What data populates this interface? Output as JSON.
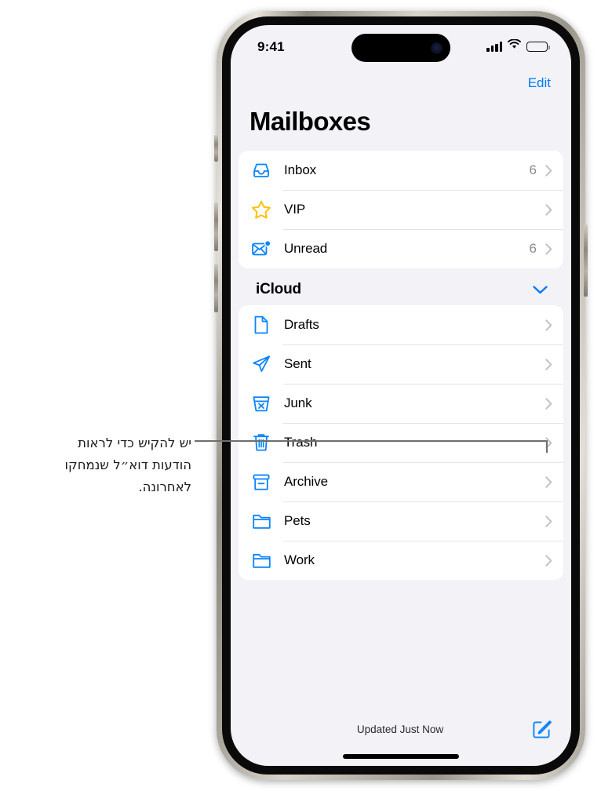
{
  "callout": {
    "lines": [
      "יש להקיש כדי לראות",
      "הודעות דוא״ל שנמחקו",
      "לאחרונה."
    ],
    "target_row": "Trash"
  },
  "status_bar": {
    "time": "9:41",
    "cellular_icon": "cellular-bars-icon",
    "wifi_icon": "wifi-icon",
    "battery_icon": "battery-icon",
    "battery_level": 100
  },
  "nav": {
    "edit_label": "Edit",
    "title": "Mailboxes"
  },
  "colors": {
    "accent": "#007aff",
    "star": "#ffc107",
    "screen_bg": "#f2f2f7",
    "card_bg": "#ffffff",
    "chevron": "#c2c2c7",
    "count_text": "#8a8a8e",
    "leader_line": "#6e6e6e"
  },
  "favorites": [
    {
      "label": "Inbox",
      "icon": "inbox-tray-icon",
      "count": "6",
      "chevron": "chevron-right-icon"
    },
    {
      "label": "VIP",
      "icon": "star-icon",
      "count": "",
      "chevron": "chevron-right-icon"
    },
    {
      "label": "Unread",
      "icon": "unread-envelope-icon",
      "count": "6",
      "chevron": "chevron-right-icon"
    }
  ],
  "section": {
    "title": "iCloud",
    "collapse_icon": "chevron-down-icon"
  },
  "mailboxes": [
    {
      "label": "Drafts",
      "icon": "document-icon",
      "count": "",
      "chevron": "chevron-right-icon"
    },
    {
      "label": "Sent",
      "icon": "paper-plane-icon",
      "count": "",
      "chevron": "chevron-right-icon"
    },
    {
      "label": "Junk",
      "icon": "junk-bin-icon",
      "count": "",
      "chevron": "chevron-right-icon"
    },
    {
      "label": "Trash",
      "icon": "trash-can-icon",
      "count": "",
      "chevron": "chevron-right-icon"
    },
    {
      "label": "Archive",
      "icon": "archive-box-icon",
      "count": "",
      "chevron": "chevron-right-icon"
    },
    {
      "label": "Pets",
      "icon": "folder-icon",
      "count": "",
      "chevron": "chevron-right-icon"
    },
    {
      "label": "Work",
      "icon": "folder-icon",
      "count": "",
      "chevron": "chevron-right-icon"
    }
  ],
  "toolbar": {
    "updated_label": "Updated Just Now",
    "compose_icon": "compose-icon"
  }
}
